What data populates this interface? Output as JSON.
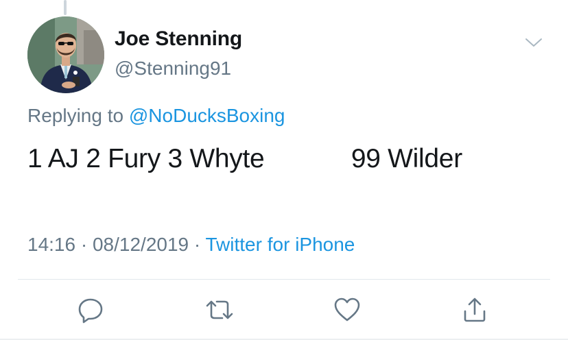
{
  "user": {
    "display_name": "Joe Stenning",
    "handle": "@Stenning91"
  },
  "reply": {
    "prefix": "Replying to",
    "mention": "@NoDucksBoxing"
  },
  "tweet": {
    "text": "1 AJ 2 Fury 3 Whyte            99 Wilder"
  },
  "meta": {
    "time": "14:16",
    "separator1": " · ",
    "date": "08/12/2019",
    "separator2": " · ",
    "source": "Twitter for iPhone"
  },
  "actions": [
    {
      "icon": "reply-icon"
    },
    {
      "icon": "retweet-icon"
    },
    {
      "icon": "like-icon"
    },
    {
      "icon": "share-icon"
    }
  ],
  "colors": {
    "text_primary": "#14171a",
    "text_secondary": "#657786",
    "link": "#1b95e0",
    "divider": "#e1e8ed"
  }
}
